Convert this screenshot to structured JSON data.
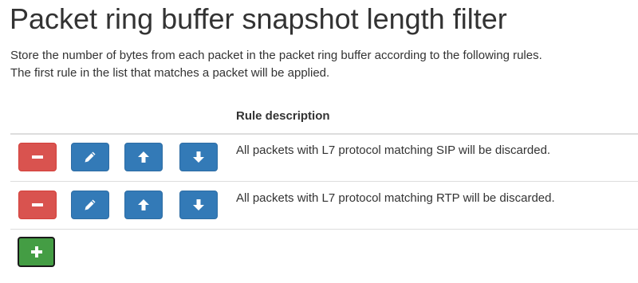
{
  "page": {
    "title": "Packet ring buffer snapshot length filter",
    "description_line1": "Store the number of bytes from each packet in the packet ring buffer according to the following rules.",
    "description_line2": "The first rule in the list that matches a packet will be applied."
  },
  "table": {
    "column_header": "Rule description",
    "rows": [
      {
        "description": "All packets with L7 protocol matching SIP will be discarded."
      },
      {
        "description": "All packets with L7 protocol matching RTP will be discarded."
      }
    ]
  },
  "icons": {
    "delete": "minus-icon",
    "edit": "pencil-icon",
    "move_up": "arrow-up-icon",
    "move_down": "arrow-down-icon",
    "add": "plus-icon"
  },
  "colors": {
    "danger": "#d9534f",
    "primary": "#337ab7",
    "success": "#449d44"
  }
}
